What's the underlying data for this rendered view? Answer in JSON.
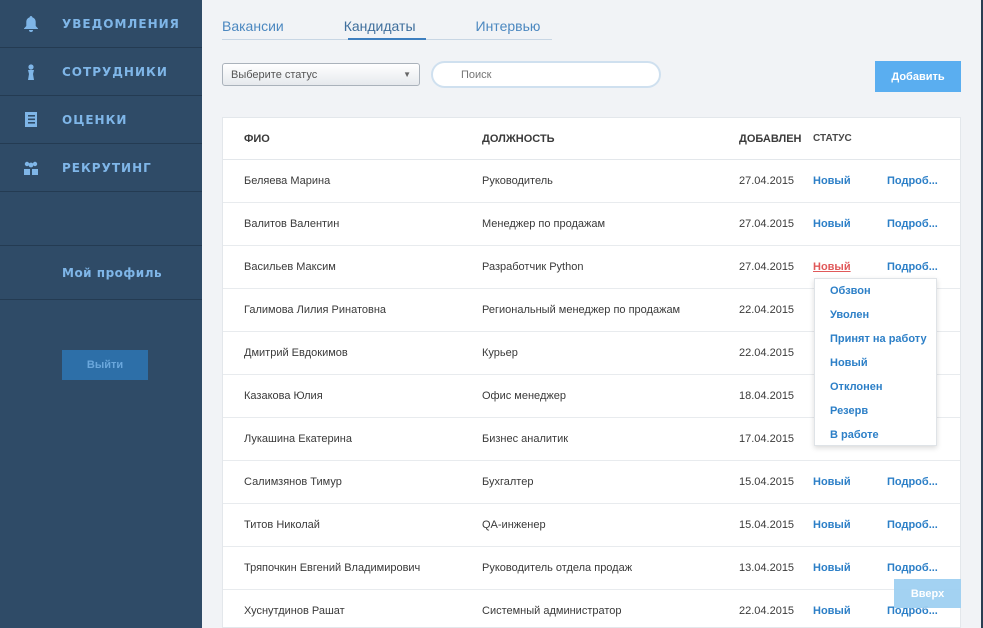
{
  "sidebar": {
    "items": [
      {
        "label": "Уведомления",
        "icon": "bell-icon"
      },
      {
        "label": "Сотрудники",
        "icon": "person-tie-icon"
      },
      {
        "label": "Оценки",
        "icon": "document-icon"
      },
      {
        "label": "Рекрутинг",
        "icon": "people-icon"
      }
    ],
    "profile_label": "Мой профиль",
    "logout_label": "Выйти"
  },
  "tabs": [
    "Вакансии",
    "Кандидаты",
    "Интервью"
  ],
  "active_tab": "Кандидаты",
  "filters": {
    "status_select_value": "Выберите статус",
    "search_placeholder": "Поиск",
    "add_label": "Добавить"
  },
  "table": {
    "headers": {
      "name": "ФИО",
      "position": "Должность",
      "added": "Добавлен",
      "status": "Статус"
    },
    "more_label": "Подроб...",
    "rows": [
      {
        "name": "Беляева Марина",
        "position": "Руководитель",
        "date": "27.04.2015",
        "status": "Новый"
      },
      {
        "name": "Валитов Валентин",
        "position": "Менеджер по продажам",
        "date": "27.04.2015",
        "status": "Новый"
      },
      {
        "name": "Васильев Максим",
        "position": "Разработчик Python",
        "date": "27.04.2015",
        "status": "Новый"
      },
      {
        "name": "Галимова Лилия Ринатовна",
        "position": "Региональный менеджер по продажам",
        "date": "22.04.2015",
        "status": ""
      },
      {
        "name": "Дмитрий Евдокимов",
        "position": "Курьер",
        "date": "22.04.2015",
        "status": ""
      },
      {
        "name": "Казакова Юлия",
        "position": "Офис менеджер",
        "date": "18.04.2015",
        "status": ""
      },
      {
        "name": "Лукашина Екатерина",
        "position": "Бизнес аналитик",
        "date": "17.04.2015",
        "status": ""
      },
      {
        "name": "Салимзянов Тимур",
        "position": "Бухгалтер",
        "date": "15.04.2015",
        "status": "Новый"
      },
      {
        "name": "Титов Николай",
        "position": "QA-инженер",
        "date": "15.04.2015",
        "status": "Новый"
      },
      {
        "name": "Тряпочкин Евгений Владимирович",
        "position": "Руководитель отдела продаж",
        "date": "13.04.2015",
        "status": "Новый"
      },
      {
        "name": "Хуснутдинов Рашат",
        "position": "Системный администратор",
        "date": "22.04.2015",
        "status": "Новый"
      }
    ]
  },
  "status_dropdown": {
    "options": [
      "Обзвон",
      "Уволен",
      "Принят на работу",
      "Новый",
      "Отклонен",
      "Резерв",
      "В работе"
    ]
  },
  "scroll_top_label": "Вверх",
  "colors": {
    "accent": "#2c7fc7",
    "sidebar": "#2f4b67",
    "open_status": "#e0595a"
  }
}
